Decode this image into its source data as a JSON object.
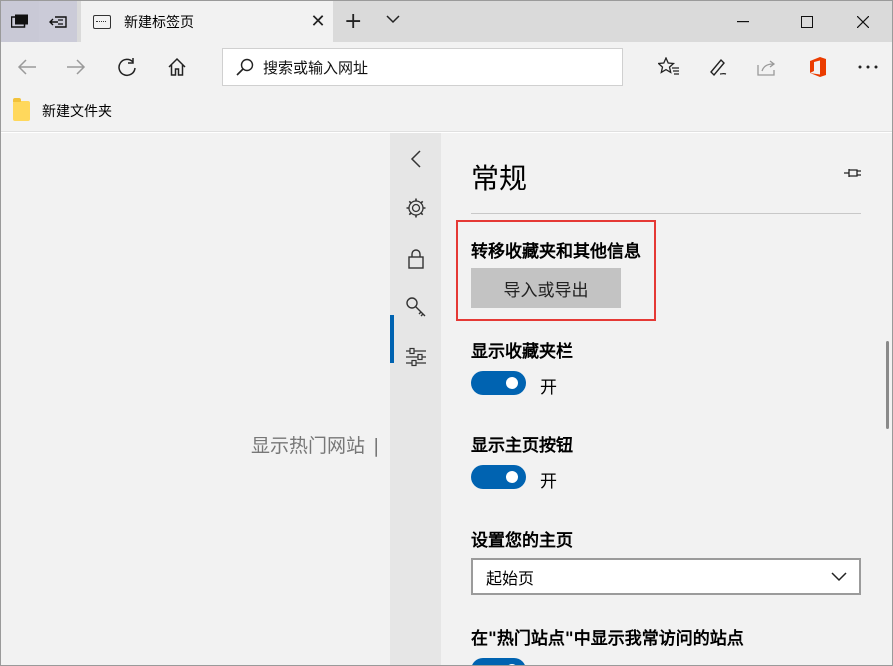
{
  "tab": {
    "title": "新建标签页"
  },
  "address": {
    "placeholder": "搜索或输入网址"
  },
  "favorites_bar": {
    "items": [
      {
        "label": "新建文件夹",
        "icon": "folder-icon"
      }
    ]
  },
  "new_tab_page": {
    "hot_sites_label": "显示热门网站",
    "separator": "|"
  },
  "settings": {
    "title": "常规",
    "transfer": {
      "heading": "转移收藏夹和其他信息",
      "button": "导入或导出"
    },
    "show_favorites_bar": {
      "heading": "显示收藏夹栏",
      "state": "开",
      "on": true
    },
    "show_home_button": {
      "heading": "显示主页按钮",
      "state": "开",
      "on": true
    },
    "homepage": {
      "heading": "设置您的主页",
      "selected": "起始页"
    },
    "top_sites": {
      "heading": "在\"热门站点\"中显示我常访问的站点",
      "state": "开",
      "on": true
    }
  },
  "colors": {
    "accent": "#0063b1",
    "highlight_border": "#e53935",
    "office_orange": "#eb3c00"
  }
}
